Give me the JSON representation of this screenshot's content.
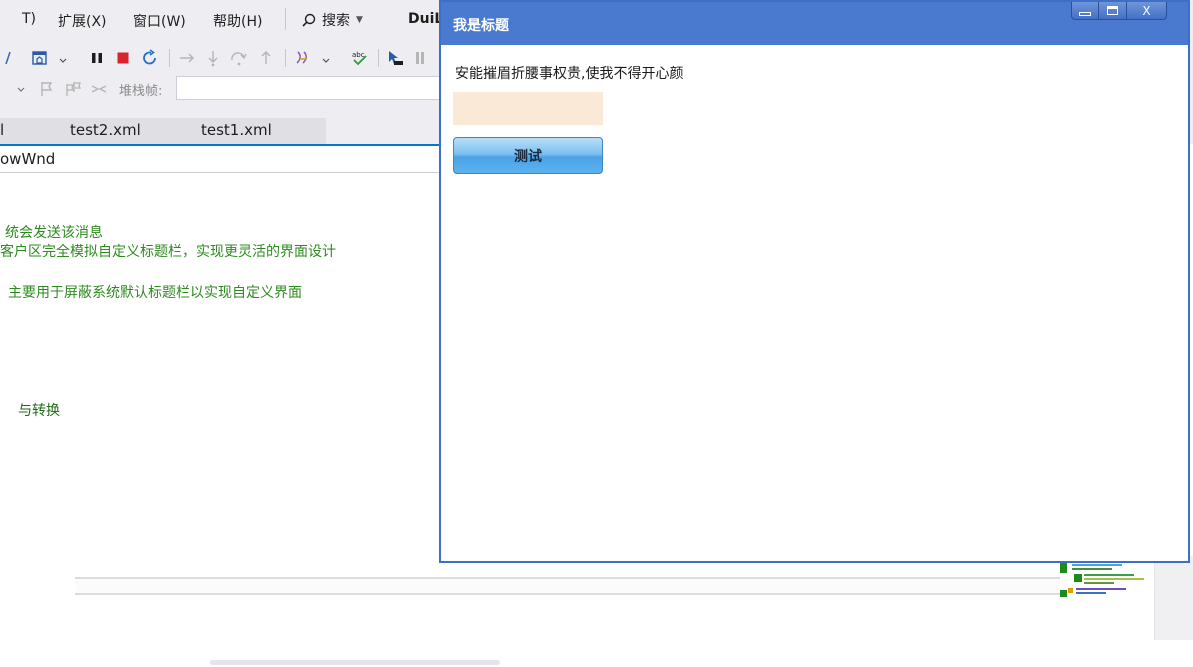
{
  "menu": {
    "items": [
      "T)",
      "扩展(X)",
      "窗口(W)",
      "帮助(H)"
    ],
    "search_label": "搜索",
    "solution_name": "DuiL"
  },
  "toolbar": {
    "icons": [
      "save-layout-icon",
      "pause-icon",
      "stop-icon",
      "restart-icon",
      "step-into-icon",
      "step-over-icon",
      "step-out-icon",
      "hot-reload-icon",
      "spellcheck-icon",
      "pointer-icon"
    ]
  },
  "stackbar": {
    "label": "堆栈帧:"
  },
  "tabs": [
    "l",
    "test2.xml",
    "test1.xml"
  ],
  "nav": {
    "text": "owWnd"
  },
  "code": {
    "lines": [
      "统会发送该消息",
      "客户区完全模拟自定义标题栏，实现更灵活的界面设计",
      "主要用于屏蔽系统默认标题栏以实现自定义界面",
      "与转换"
    ]
  },
  "dialog": {
    "title": "我是标题",
    "message": "安能摧眉折腰事权贵,使我不得开心颜",
    "input_value": "",
    "button_label": "测试",
    "close_label": "X"
  },
  "colors": {
    "title_bar": "#4a7ad0",
    "input_bg": "#fbe9d7",
    "button_top": "#b9def8",
    "button_bottom": "#4aa3e8",
    "code_comment": "#2e8b20",
    "accent": "#007acc"
  }
}
